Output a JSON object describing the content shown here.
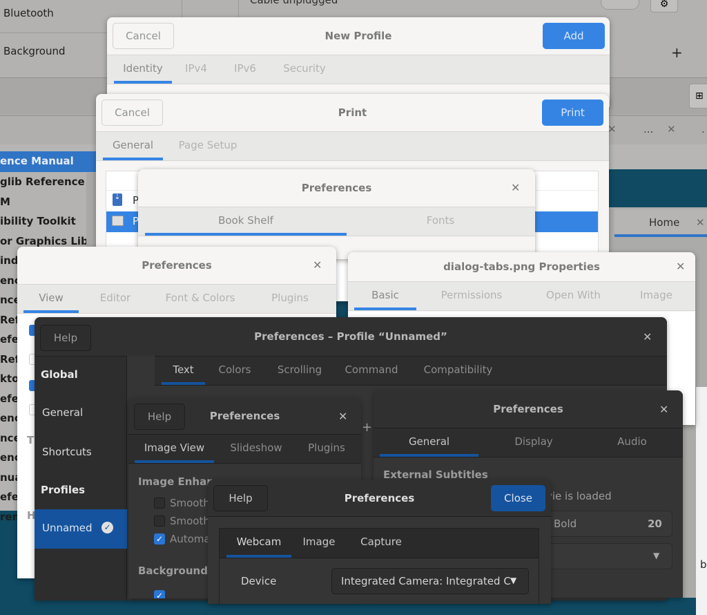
{
  "background": {
    "settings": {
      "sidebar_items": [
        "Bluetooth",
        "Background"
      ],
      "cable_status": "Cable unplugged",
      "add_icon": "plus-icon",
      "gear_icon": "gear-icon"
    },
    "devhelp": {
      "books": [
        "ence Manual",
        "glib Reference M",
        "ibility Toolkit",
        "or Graphics Libr",
        "indings - Refere",
        "ence",
        "nce",
        "Refe",
        "efe",
        "Refe",
        "ktop",
        "efer",
        "ence",
        "nce",
        "ence",
        "nua",
        "efer",
        "renc"
      ],
      "tab_home": "Home",
      "tab_ellipsis": "..."
    },
    "right_text": "b"
  },
  "new_profile": {
    "title": "New Profile",
    "cancel": "Cancel",
    "add": "Add",
    "tabs": [
      "Identity",
      "IPv4",
      "IPv6",
      "Security"
    ]
  },
  "print": {
    "title": "Print",
    "cancel": "Cancel",
    "print": "Print",
    "tabs": [
      "General",
      "Page Setup"
    ],
    "printers": [
      "P",
      "P"
    ]
  },
  "bookshelf_prefs": {
    "title": "Preferences",
    "tabs": [
      "Book Shelf",
      "Fonts"
    ]
  },
  "editor_prefs": {
    "title": "Preferences",
    "tabs": [
      "View",
      "Editor",
      "Font & Colors",
      "Plugins"
    ],
    "partial_labels": [
      "T",
      "H"
    ],
    "checks": [
      true,
      false,
      true,
      false
    ]
  },
  "properties": {
    "title": "dialog-tabs.png Properties",
    "tabs": [
      "Basic",
      "Permissions",
      "Open With",
      "Image"
    ]
  },
  "terminal_prefs": {
    "title": "Preferences – Profile “Unnamed”",
    "help": "Help",
    "sidebar": {
      "global_heading": "Global",
      "items": [
        "General",
        "Shortcuts"
      ],
      "profiles_heading": "Profiles",
      "profile": "Unnamed"
    },
    "tabs": [
      "Text",
      "Colors",
      "Scrolling",
      "Command",
      "Compatibility"
    ]
  },
  "image_prefs": {
    "title": "Preferences",
    "help": "Help",
    "tabs": [
      "Image View",
      "Slideshow",
      "Plugins"
    ],
    "section1": "Image Enhan",
    "options": [
      {
        "label": "Smooth",
        "checked": false
      },
      {
        "label": "Smooth",
        "checked": false
      },
      {
        "label": "Automa",
        "checked": true
      }
    ],
    "section2": "Background",
    "plus": "+"
  },
  "video_prefs": {
    "title": "Preferences",
    "tabs": [
      "General",
      "Display",
      "Audio"
    ],
    "section": "External Subtitles",
    "load_label": "vie is loaded",
    "font_name": "Bold",
    "font_size": "20"
  },
  "webcam_prefs": {
    "title": "Preferences",
    "help": "Help",
    "close": "Close",
    "tabs": [
      "Webcam",
      "Image",
      "Capture"
    ],
    "device_label": "Device",
    "device_value": "Integrated Camera: Integrated C"
  }
}
